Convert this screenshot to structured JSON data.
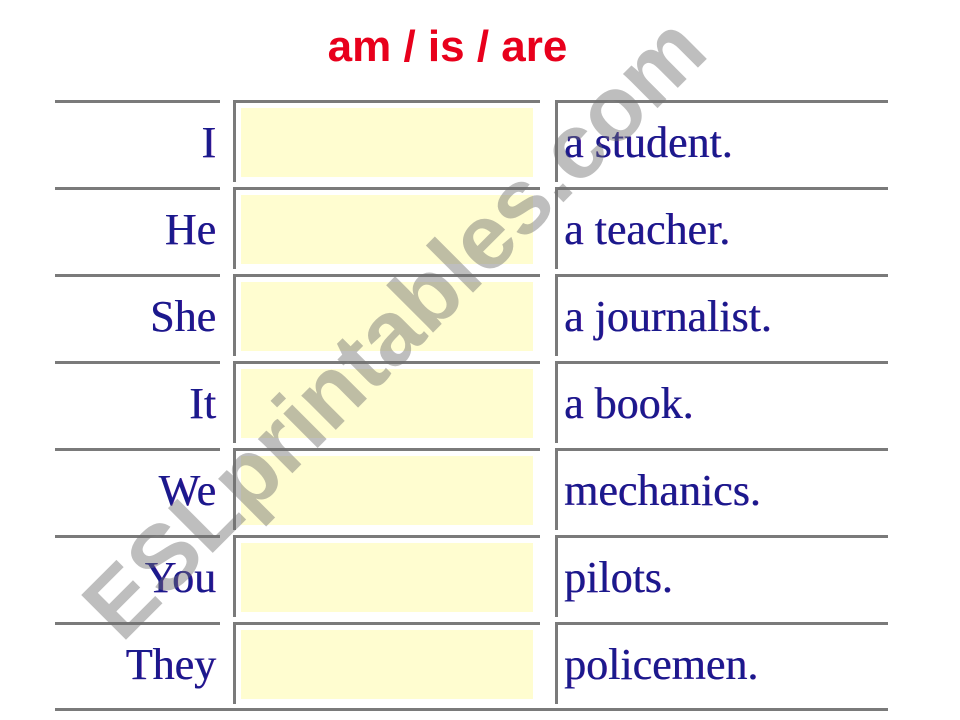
{
  "title": "am / is / are",
  "rows": [
    {
      "pronoun": "I",
      "answer": "",
      "phrase": "a student."
    },
    {
      "pronoun": "He",
      "answer": "",
      "phrase": "a teacher."
    },
    {
      "pronoun": "She",
      "answer": "",
      "phrase": "a journalist."
    },
    {
      "pronoun": "It",
      "answer": "",
      "phrase": "a book."
    },
    {
      "pronoun": "We",
      "answer": "",
      "phrase": "mechanics."
    },
    {
      "pronoun": "You",
      "answer": "",
      "phrase": "pilots."
    },
    {
      "pronoun": "They",
      "answer": "",
      "phrase": "policemen."
    }
  ],
  "watermark": "ESLprintables.com",
  "colors": {
    "title": "#e8001c",
    "text": "#1a1a8c",
    "input_fill": "#fffdd0",
    "border": "#7a7a7a"
  }
}
